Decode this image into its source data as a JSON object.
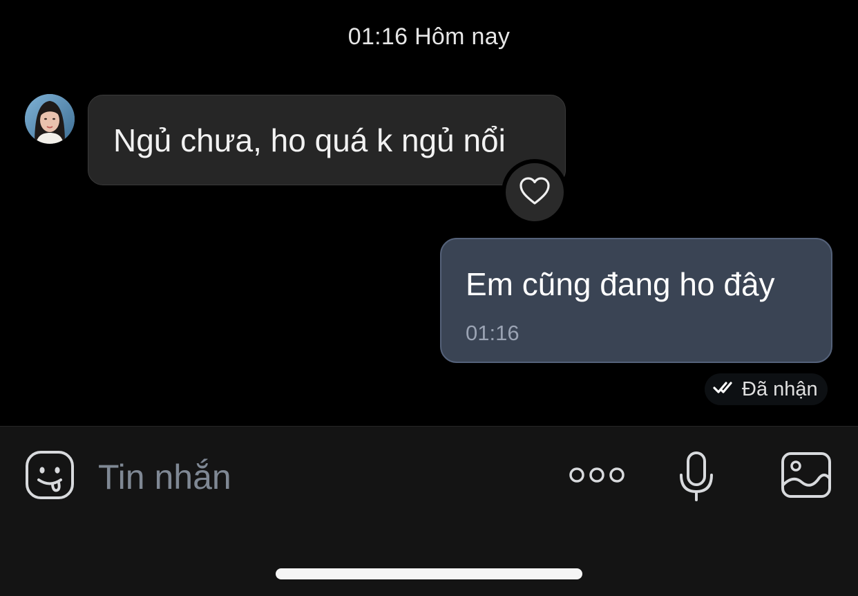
{
  "conversation": {
    "date_header": "01:16 Hôm nay",
    "incoming_message": {
      "text": "Ngủ chưa, ho quá k ngủ nổi",
      "reaction_icon": "heart-outline-icon"
    },
    "outgoing_message": {
      "text": "Em cũng đang ho đây",
      "time": "01:16",
      "status": "Đã nhận",
      "status_icon": "double-check-icon"
    }
  },
  "composer": {
    "placeholder": "Tin nhắn",
    "value": "",
    "icons": [
      "emoji-sticker-icon",
      "more-options-icon",
      "microphone-icon",
      "image-gallery-icon"
    ]
  },
  "colors": {
    "background": "#000000",
    "incoming_bubble": "#262626",
    "outgoing_bubble": "#3a4454",
    "composer_bar": "#141414",
    "placeholder": "#7f8894"
  }
}
